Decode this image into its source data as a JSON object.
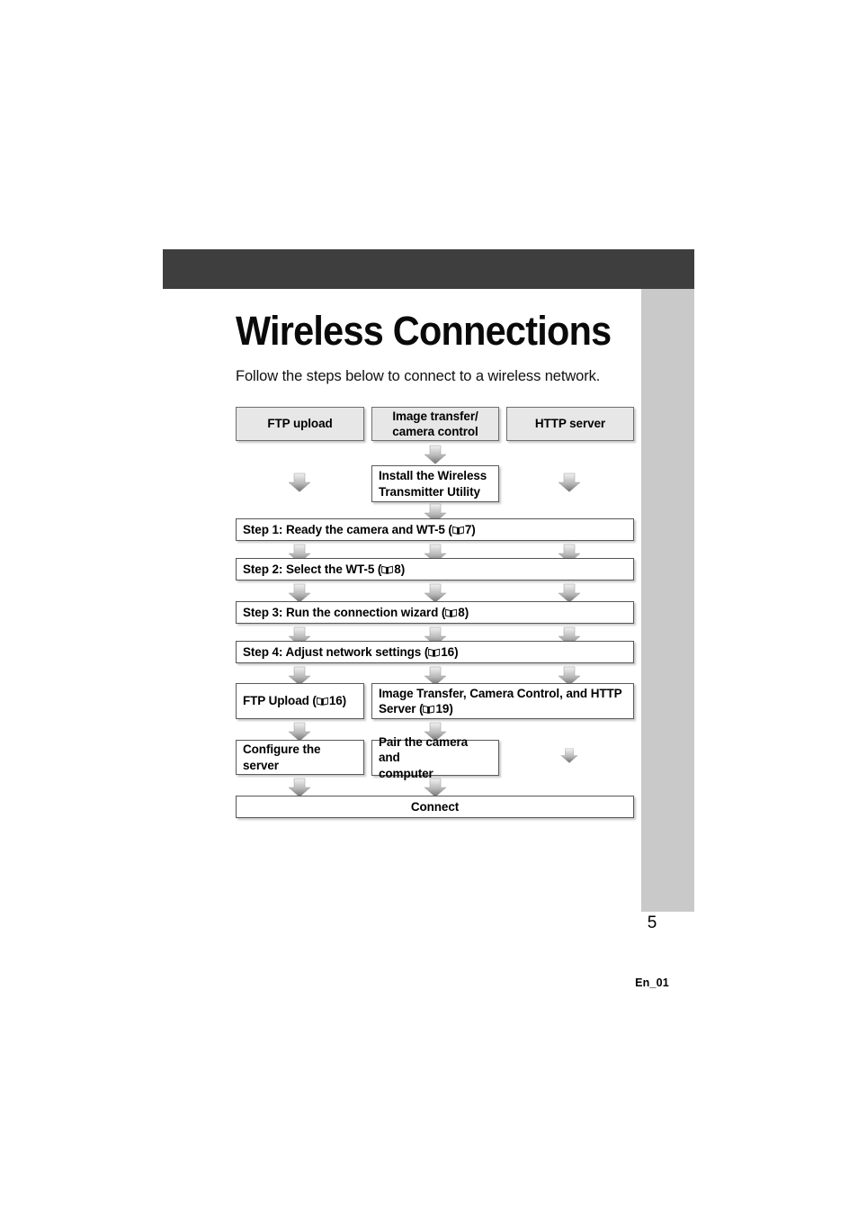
{
  "page": {
    "title": "Wireless Connections",
    "subtitle": "Follow the steps below to connect to a wireless network.",
    "page_number": "5",
    "footer_code": "En_01",
    "header_bar_color": "#3e3e3e",
    "side_tab_color": "#c9c9c9",
    "shaded_box_color": "#e7e7e7"
  },
  "flowchart": {
    "type": "flow-diagram",
    "columns": [
      {
        "id": "ftp",
        "label": "FTP upload"
      },
      {
        "id": "image-transfer",
        "label": "Image transfer/\ncamera control"
      },
      {
        "id": "http",
        "label": "HTTP server"
      }
    ],
    "boxes": [
      {
        "id": "ftp-upload",
        "text": "FTP upload",
        "shaded": true,
        "align": "center"
      },
      {
        "id": "image-transfer",
        "text": "Image transfer/",
        "text2": "camera control",
        "shaded": true,
        "align": "center"
      },
      {
        "id": "http-server",
        "text": "HTTP server",
        "shaded": true,
        "align": "center"
      },
      {
        "id": "install-utility",
        "text": "Install the Wireless",
        "text2": "Transmitter Utility",
        "shaded": false,
        "align": "left"
      },
      {
        "id": "step-1",
        "text": "Step 1: Ready the camera and WT-5 (",
        "page_ref": "7",
        "suffix": ")",
        "shaded": false,
        "align": "left"
      },
      {
        "id": "step-2",
        "text": "Step 2: Select the WT-5 (",
        "page_ref": "8",
        "suffix": ")",
        "shaded": false,
        "align": "left"
      },
      {
        "id": "step-3",
        "text": "Step 3: Run the connection wizard (",
        "page_ref": "8",
        "suffix": ")",
        "shaded": false,
        "align": "left"
      },
      {
        "id": "step-4",
        "text": "Step 4: Adjust network settings (",
        "page_ref": "16",
        "suffix": ")",
        "shaded": false,
        "align": "left"
      },
      {
        "id": "ftp-upload-ref",
        "text": "FTP Upload (",
        "page_ref": "16",
        "suffix": ")",
        "shaded": false,
        "align": "left"
      },
      {
        "id": "image-transfer-ref",
        "text": "Image Transfer, Camera Control, and HTTP",
        "text2": "Server (",
        "page_ref2": "19",
        "suffix2": ")",
        "shaded": false,
        "align": "left"
      },
      {
        "id": "configure-server",
        "text": "Configure the server",
        "shaded": false,
        "align": "left"
      },
      {
        "id": "pair-camera",
        "text": "Pair the camera and",
        "text2": "computer",
        "shaded": false,
        "align": "left"
      },
      {
        "id": "connect",
        "text": "Connect",
        "shaded": false,
        "align": "center"
      }
    ],
    "icon_name": "open-book-icon",
    "arrow_icon_name": "arrow-down-icon"
  }
}
